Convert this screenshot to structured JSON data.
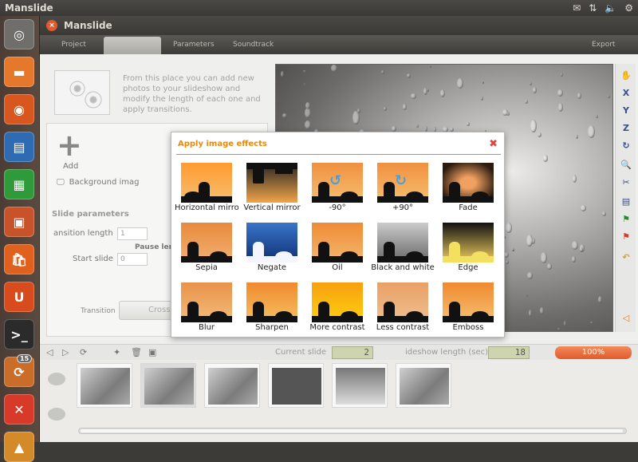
{
  "system": {
    "app_title": "Manslide",
    "tray_icons": [
      "mail-icon",
      "network-icon",
      "sound-icon",
      "power-icon"
    ]
  },
  "launcher": {
    "items": [
      {
        "name": "ubuntu-dash",
        "color": "#6f6e6a"
      },
      {
        "name": "files",
        "color": "#e6782c"
      },
      {
        "name": "firefox",
        "color": "#d8571e"
      },
      {
        "name": "writer",
        "color": "#2f6bb2"
      },
      {
        "name": "calc",
        "color": "#2f9a3a"
      },
      {
        "name": "impress",
        "color": "#c8532a"
      },
      {
        "name": "software-center",
        "color": "#e0611d"
      },
      {
        "name": "ubuntu-one",
        "color": "#d84b1c"
      },
      {
        "name": "terminal",
        "color": "#2b2b2b"
      },
      {
        "name": "update-manager",
        "color": "#c96d29"
      },
      {
        "name": "settings",
        "color": "#d83a2a"
      },
      {
        "name": "manslide",
        "color": "#d58a2a"
      }
    ],
    "badge": "15"
  },
  "window": {
    "title": "Manslide",
    "tabs": {
      "project": "Project",
      "photos": "",
      "parameters": "Parameters",
      "soundtrack": "Soundtrack",
      "export": "Export"
    }
  },
  "left_panel": {
    "intro": "From this place you can add new photos to your slideshow and modify the length of each one and apply transitions.",
    "add_label": "Add",
    "background_label": "Background imag",
    "slide_parameters": "Slide parameters",
    "transition_length_label": "ansition length",
    "transition_length_value": "1",
    "pause_label": "Pause leng",
    "start_slide_label": "Start slide",
    "start_slide_value": "0",
    "transition_label": "Transition",
    "transition_value": "Crossf"
  },
  "dialog": {
    "title": "Apply image effects",
    "effects": [
      {
        "label": "Horizontal mirror",
        "colors": [
          "#ff9a30",
          "#f6c070"
        ],
        "variant": "mirror-h"
      },
      {
        "label": "Vertical mirror",
        "colors": [
          "#f1a54a",
          "#222222"
        ],
        "variant": "mirror-v"
      },
      {
        "label": "-90°",
        "colors": [
          "#f09040",
          "#f6c070"
        ],
        "variant": "rotate-left"
      },
      {
        "label": "+90°",
        "colors": [
          "#f09040",
          "#f6c070"
        ],
        "variant": "rotate-right"
      },
      {
        "label": "Fade",
        "colors": [
          "#f0a060",
          "#2a1a10"
        ],
        "variant": "fade"
      },
      {
        "label": "Sepia",
        "colors": [
          "#e88a3c",
          "#f2b072"
        ],
        "variant": "sepia"
      },
      {
        "label": "Negate",
        "colors": [
          "#3b74c8",
          "#0d2f74"
        ],
        "variant": "negate"
      },
      {
        "label": "Oil",
        "colors": [
          "#ef8b35",
          "#f3b86e"
        ],
        "variant": "oil"
      },
      {
        "label": "Black and white",
        "colors": [
          "#cccccc",
          "#666666"
        ],
        "variant": "bw"
      },
      {
        "label": "Edge",
        "colors": [
          "#111111",
          "#f2d060"
        ],
        "variant": "edge"
      },
      {
        "label": "Blur",
        "colors": [
          "#e8934a",
          "#f3bc7a"
        ],
        "variant": "blur"
      },
      {
        "label": "Sharpen",
        "colors": [
          "#ef8a30",
          "#f6c060"
        ],
        "variant": "sharpen"
      },
      {
        "label": "More contrast",
        "colors": [
          "#f7a010",
          "#ffd010"
        ],
        "variant": "more-contrast"
      },
      {
        "label": "Less contrast",
        "colors": [
          "#e8a066",
          "#f1c090"
        ],
        "variant": "less-contrast"
      },
      {
        "label": "Emboss",
        "colors": [
          "#ef8a30",
          "#f6c070"
        ],
        "variant": "emboss"
      }
    ]
  },
  "bottom": {
    "current_slide_label": "Current slide",
    "current_slide_value": "2",
    "length_label": "ideshow length (sec)",
    "length_value": "18",
    "progress": "100%",
    "progress_fraction": 1.0
  },
  "filmstrip": {
    "slides": 6,
    "active_index": 1
  }
}
